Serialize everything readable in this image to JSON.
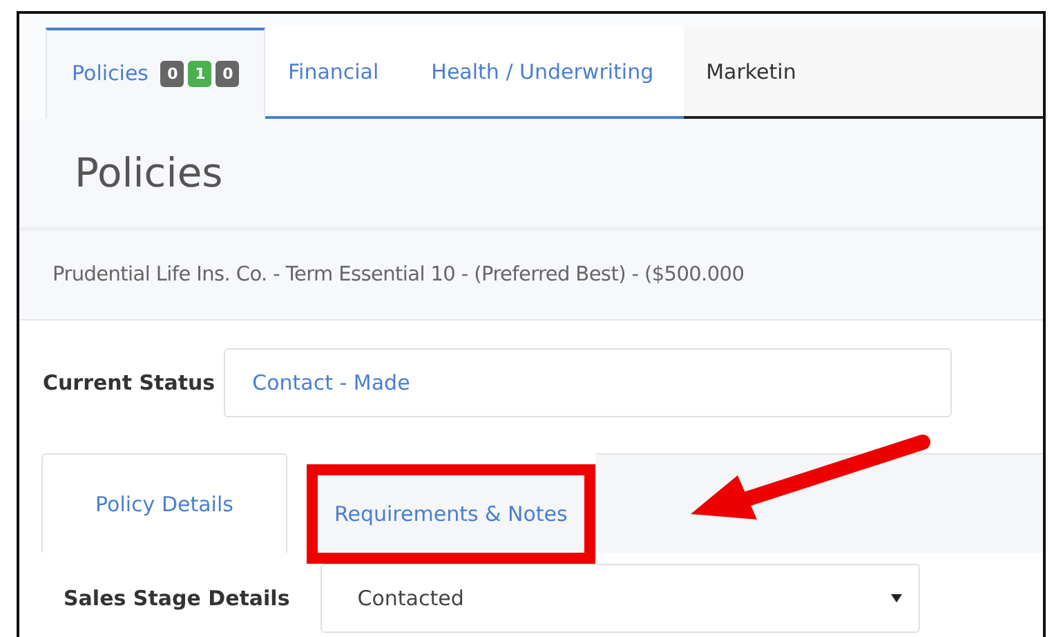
{
  "tabs": [
    {
      "label": "Policies",
      "selected": true,
      "badges": [
        {
          "text": "0",
          "color": "#666666"
        },
        {
          "text": "1",
          "color": "#4caf50"
        },
        {
          "text": "0",
          "color": "#666666"
        }
      ]
    },
    {
      "label": "Financial",
      "selected": false
    },
    {
      "label": "Health / Underwriting",
      "selected": false
    },
    {
      "label": "Marketin",
      "selected": false
    }
  ],
  "heading": "Policies",
  "policy_summary": "Prudential Life Ins. Co. - Term Essential 10 - (Preferred Best) - ($500.000",
  "current_status": {
    "label": "Current Status",
    "value": "Contact - Made"
  },
  "sub_tabs": [
    {
      "label": "Policy Details",
      "selected": true,
      "highlighted": false
    },
    {
      "label": "Requirements & Notes",
      "selected": false,
      "highlighted": true
    }
  ],
  "sales_stage": {
    "label": "Sales Stage Details",
    "value": "Contacted"
  }
}
